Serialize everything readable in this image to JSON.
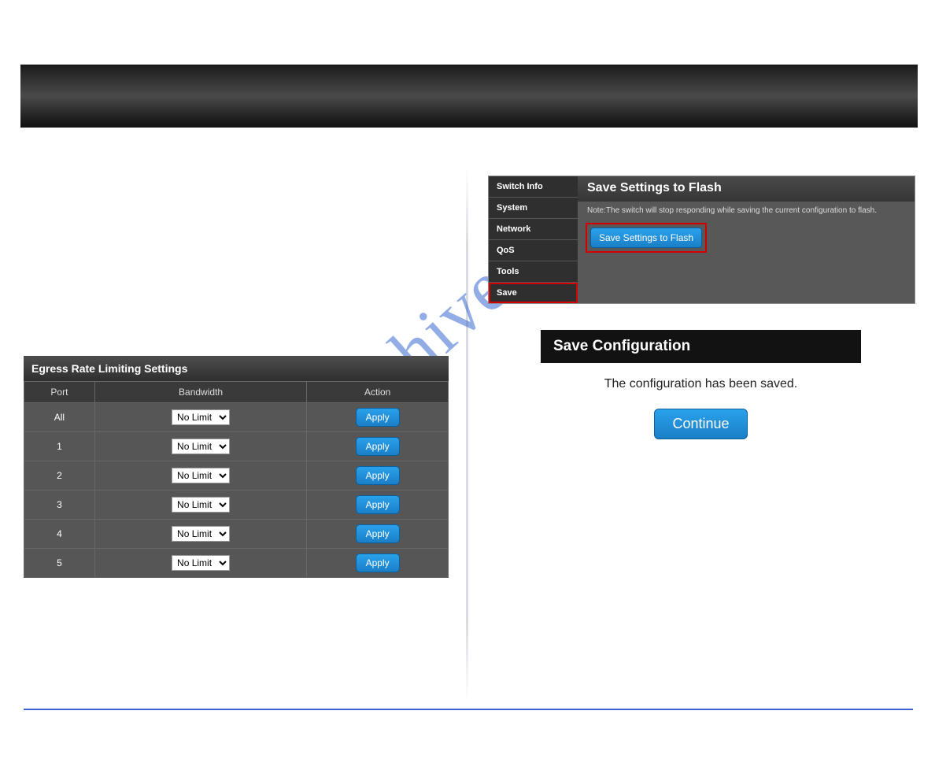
{
  "watermark": "manualshive.co",
  "left": {
    "section_link": "",
    "egress": {
      "title": "Egress Rate Limiting Settings",
      "headers": {
        "port": "Port",
        "bandwidth": "Bandwidth",
        "action": "Action"
      },
      "option_default": "No Limit",
      "apply_label": "Apply",
      "rows": [
        {
          "port": "All"
        },
        {
          "port": "1"
        },
        {
          "port": "2"
        },
        {
          "port": "3"
        },
        {
          "port": "4"
        },
        {
          "port": "5"
        }
      ]
    }
  },
  "right": {
    "flash": {
      "sidebar": {
        "switch_info": "Switch Info",
        "system": "System",
        "network": "Network",
        "qos": "QoS",
        "tools": "Tools",
        "save": "Save"
      },
      "title": "Save Settings to Flash",
      "note": "Note:The switch will stop responding while saving the current configuration to flash.",
      "button": "Save Settings to Flash"
    },
    "save_conf": {
      "title": "Save Configuration",
      "message": "The configuration has been saved.",
      "button": "Continue"
    }
  }
}
